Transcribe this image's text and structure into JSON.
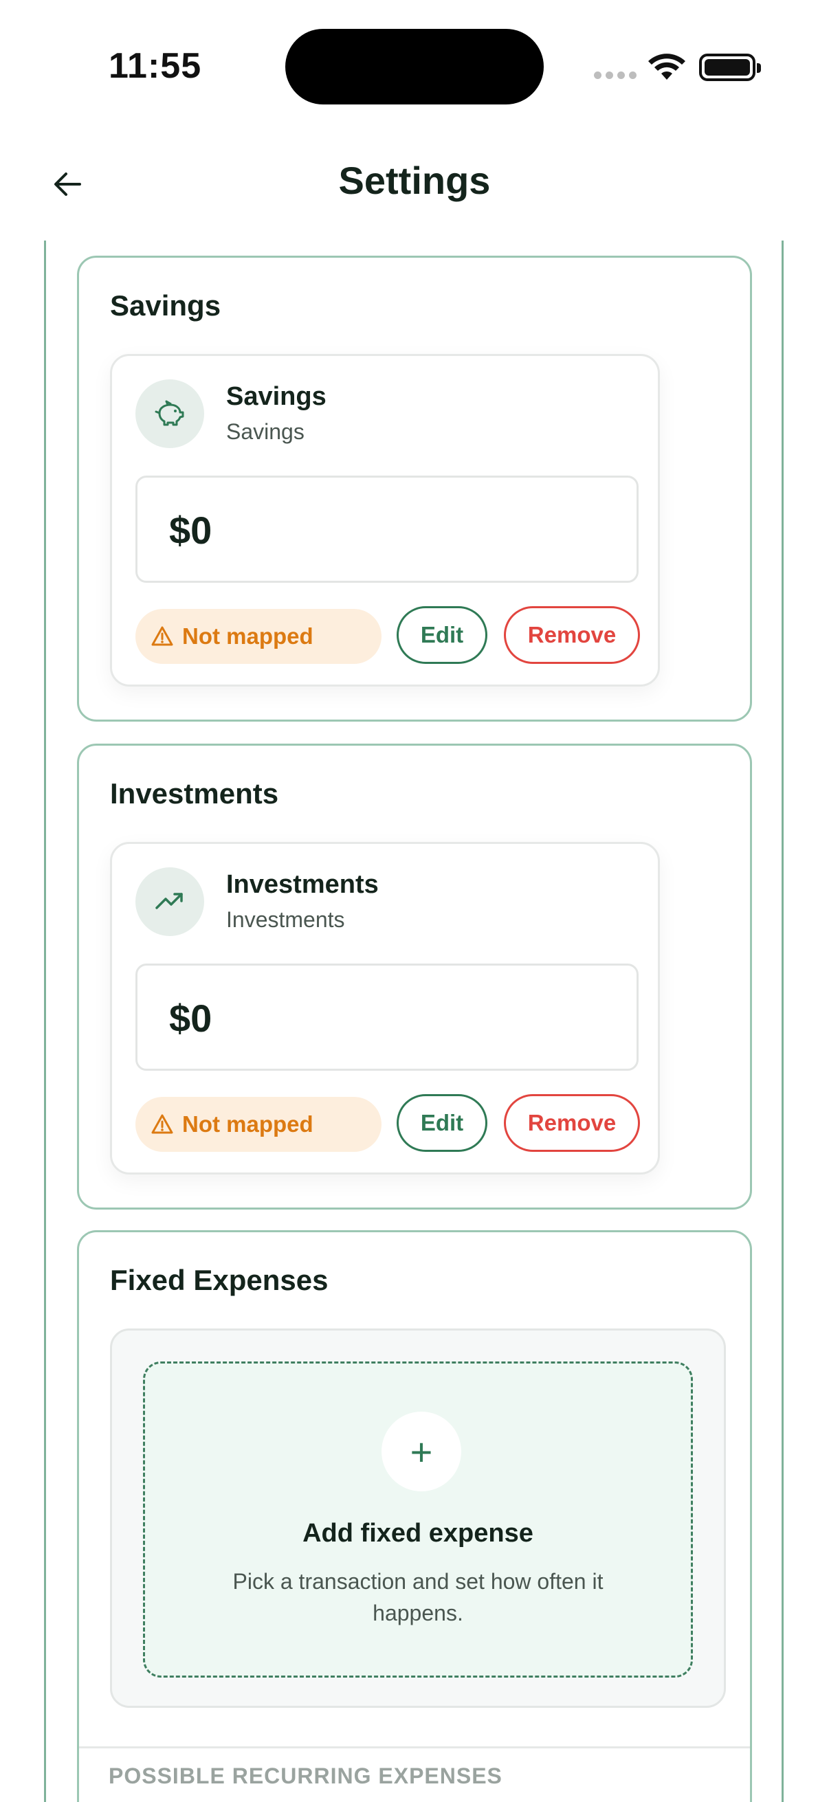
{
  "status_bar": {
    "time": "11:55"
  },
  "header": {
    "title": "Settings",
    "back_icon": "arrow-left-icon"
  },
  "sections": [
    {
      "title": "Savings",
      "account": {
        "icon": "piggy-bank-icon",
        "name": "Savings",
        "type": "Savings",
        "amount": "$0",
        "status": "Not mapped",
        "edit_label": "Edit",
        "remove_label": "Remove"
      }
    },
    {
      "title": "Investments",
      "account": {
        "icon": "trending-up-icon",
        "name": "Investments",
        "type": "Investments",
        "amount": "$0",
        "status": "Not mapped",
        "edit_label": "Edit",
        "remove_label": "Remove"
      }
    }
  ],
  "fixed_expenses": {
    "title": "Fixed Expenses",
    "add_icon": "+",
    "add_title": "Add fixed expense",
    "add_description": "Pick a transaction and set how often it happens.",
    "recurring_label": "POSSIBLE RECURRING EXPENSES"
  },
  "colors": {
    "accent_green": "#2f7a55",
    "warning_orange": "#dc7a12",
    "danger_red": "#e2453f",
    "border_green": "#9cc7b3"
  }
}
